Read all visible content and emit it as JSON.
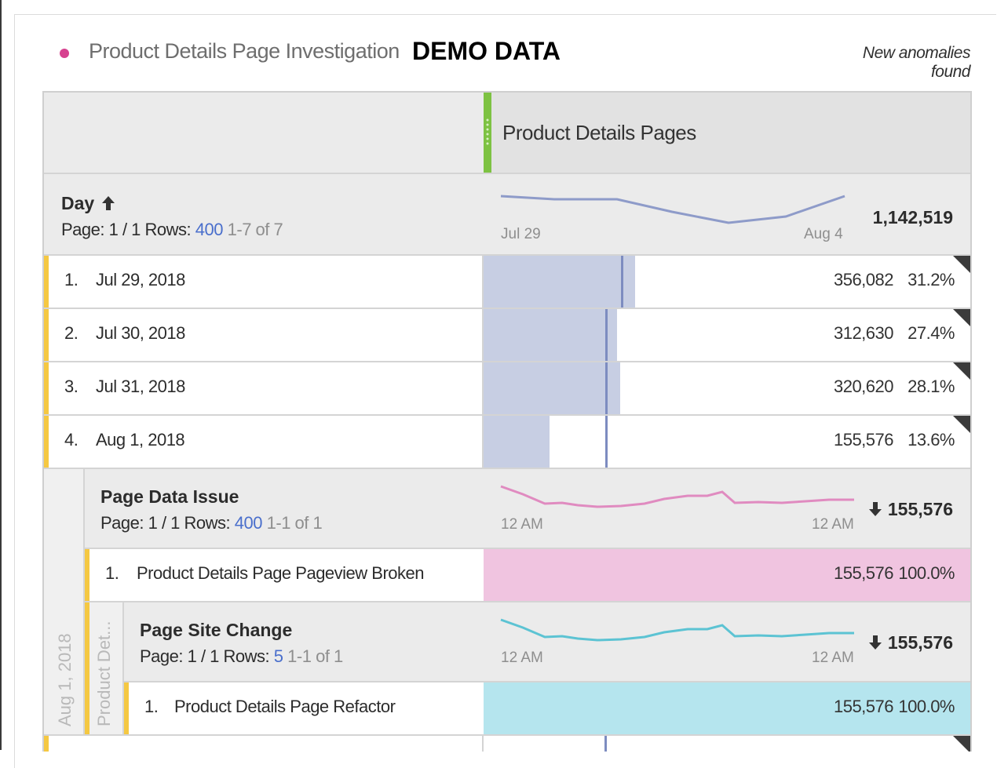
{
  "panel": {
    "title": "Product Details Page Investigation",
    "demo_label": "DEMO DATA",
    "anomalies": "New anomalies found",
    "column_header": "Product Details Pages"
  },
  "day_section": {
    "label": "Day",
    "page_text": "Page: 1 / 1",
    "rows_label": "Rows:",
    "rows_value": "400",
    "range": "1-7 of 7",
    "axis_start": "Jul 29",
    "axis_end": "Aug 4",
    "total": "1,142,519",
    "spark_color": "#8e9bc9"
  },
  "rows": [
    {
      "index": "1.",
      "label": "Jul 29, 2018",
      "value": "356,082",
      "pct": "31.2%",
      "share": 0.312
    },
    {
      "index": "2.",
      "label": "Jul 30, 2018",
      "value": "312,630",
      "pct": "27.4%",
      "share": 0.274
    },
    {
      "index": "3.",
      "label": "Jul 31, 2018",
      "value": "320,620",
      "pct": "28.1%",
      "share": 0.281
    },
    {
      "index": "4.",
      "label": "Aug 1, 2018",
      "value": "155,576",
      "pct": "13.6%",
      "share": 0.136
    }
  ],
  "page_data_issue": {
    "label": "Page Data Issue",
    "page_text": "Page: 1 / 1",
    "rows_label": "Rows:",
    "rows_value": "400",
    "range": "1-1 of 1",
    "axis_start": "12 AM",
    "axis_end": "12 AM",
    "total": "155,576",
    "spark_color": "#e08bc0",
    "row": {
      "index": "1.",
      "label": "Product Details Page Pageview Broken",
      "value": "155,576",
      "pct": "100.0%"
    },
    "fill_color": "#f0c4e0"
  },
  "page_site_change": {
    "label": "Page Site Change",
    "page_text": "Page: 1 / 1",
    "rows_label": "Rows:",
    "rows_value": "5",
    "range": "1-1 of 1",
    "axis_start": "12 AM",
    "axis_end": "12 AM",
    "total": "155,576",
    "spark_color": "#5cc3d3",
    "row": {
      "index": "1.",
      "label": "Product Details Page Refactor",
      "value": "155,576",
      "pct": "100.0%"
    },
    "fill_color": "#b5e5ee"
  },
  "nest_labels": {
    "outer": "Aug 1, 2018",
    "inner": "Product Det..."
  },
  "colors": {
    "bar_fill": "#c7cee3",
    "bar_marker": "#7d8cc0",
    "accent_green": "#7dc242",
    "row_accent": "#f5c842"
  }
}
